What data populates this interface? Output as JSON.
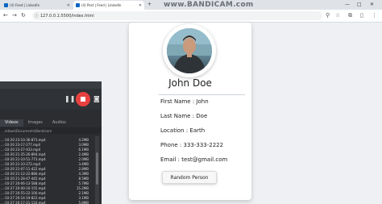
{
  "browser": {
    "tabs": [
      {
        "label": "(4) Feed | LinkedIn",
        "color": "#0a66c2"
      },
      {
        "label": "(4) Post | Feed | LinkedIn",
        "color": "#0a66c2"
      }
    ],
    "watermark": "www.BANDICAM.com",
    "url": "127.0.0.1:5500/index.html",
    "window_controls": [
      "—",
      "□",
      "✕"
    ]
  },
  "profile": {
    "name": "John Doe",
    "fields": [
      "First Name : John",
      "Last Name : Doe",
      "Location : Earth",
      "Phone : 333-333-2222",
      "Email : test@gmail.com"
    ],
    "button_label": "Random Person"
  },
  "recorder": {
    "tabs": [
      "Videos",
      "Images",
      "Audios"
    ],
    "path": "...ndows\\Documents\\Bandicam",
    "files": [
      {
        "name": "...-10-20 23-10-36-873.mp4",
        "size": "4.2MB"
      },
      {
        "name": "...-10-20 23-17-277.mp4",
        "size": "3.0MB"
      },
      {
        "name": "...-10-20 23-27-433.mp4",
        "size": "6.1MB"
      },
      {
        "name": "...-10-20 21-35-26-894.mp4",
        "size": "2.4MB"
      },
      {
        "name": "...-10-20 21-10-51-773.mp4",
        "size": "2.0MB"
      },
      {
        "name": "...-10-20 21-10-272.mp4",
        "size": "3.4MB"
      },
      {
        "name": "...-10-20 21-07-11-422.mp4",
        "size": "2.8MB"
      },
      {
        "name": "...-10-20 21-12-22-886.mp4",
        "size": "4.3MB"
      },
      {
        "name": "...-10-20 21-28-47-445.mp4",
        "size": "8.5MB"
      },
      {
        "name": "...-10-27 20-06-13-588.mp4",
        "size": "5.7MB"
      },
      {
        "name": "...-10-27 20-40-10-155.mp4",
        "size": "15.2MB"
      },
      {
        "name": "...-10-27 20-55-22-100.mp4",
        "size": "2.1MB"
      },
      {
        "name": "...-10-27 20-14-19-822.mp4",
        "size": "3.1MB"
      },
      {
        "name": "...-10-27 20-17-21-116.mp4",
        "size": "5.8MB"
      }
    ]
  }
}
